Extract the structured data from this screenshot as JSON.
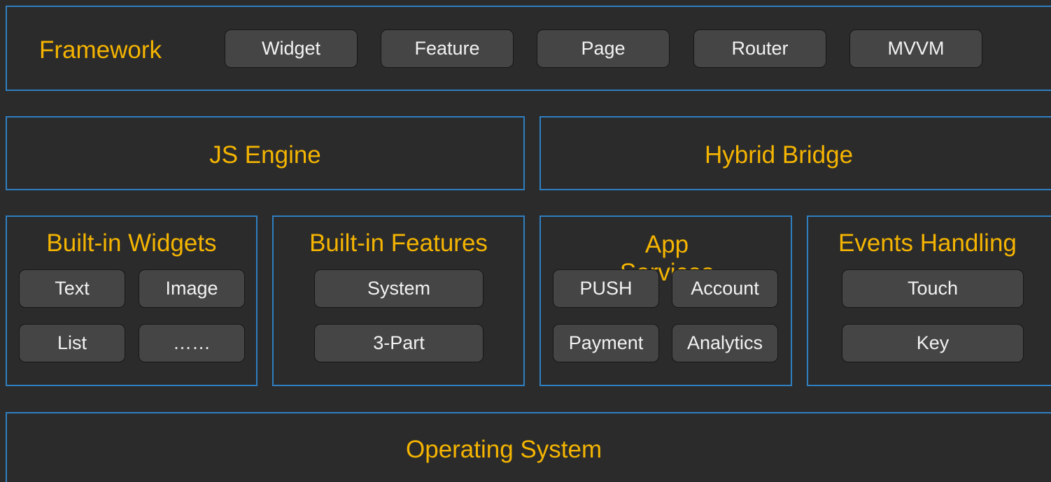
{
  "framework": {
    "title": "Framework",
    "items": [
      "Widget",
      "Feature",
      "Page",
      "Router",
      "MVVM"
    ]
  },
  "js_engine": {
    "title": "JS Engine"
  },
  "hybrid_bridge": {
    "title": "Hybrid Bridge"
  },
  "builtin_widgets": {
    "title": "Built-in Widgets",
    "items": [
      "Text",
      "Image",
      "List",
      "……"
    ]
  },
  "builtin_features": {
    "title": "Built-in Features",
    "items": [
      "System",
      "3-Part"
    ]
  },
  "app_services": {
    "title": "App Services",
    "items": [
      "PUSH",
      "Account",
      "Payment",
      "Analytics"
    ]
  },
  "events_handling": {
    "title": "Events Handling",
    "items": [
      "Touch",
      "Key"
    ]
  },
  "operating_system": {
    "title": "Operating System"
  },
  "colors": {
    "background": "#2b2b2b",
    "frame_border": "#2f7fc1",
    "title_text": "#f4b400",
    "pill_fill": "#454545",
    "pill_text": "#f2f2f2"
  }
}
